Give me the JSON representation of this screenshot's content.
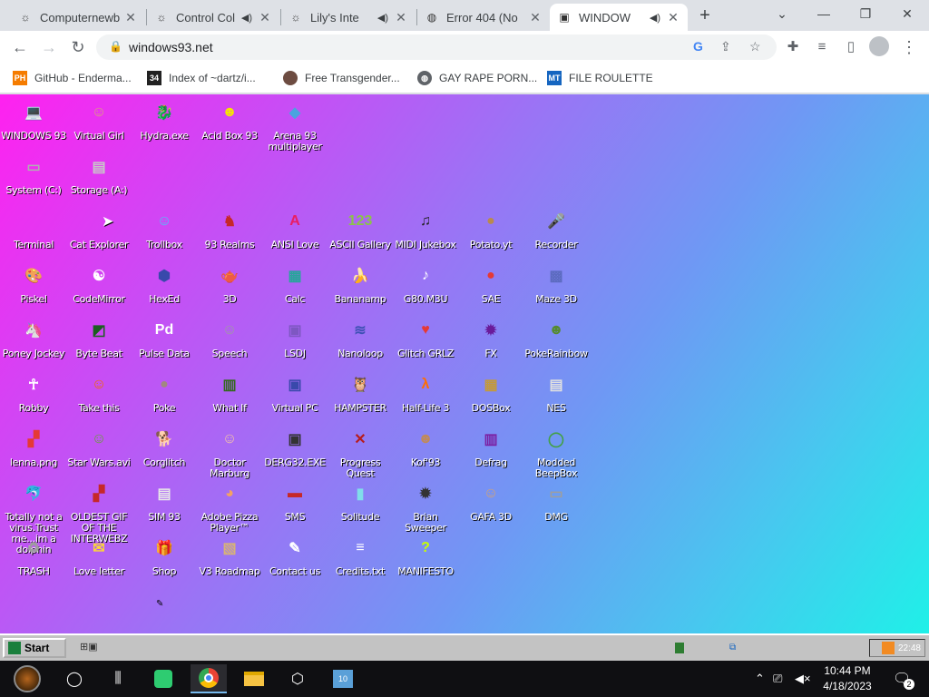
{
  "browser": {
    "tabs": [
      {
        "title": "Computernewb",
        "favicon": "c-icon",
        "audio": false,
        "active": false
      },
      {
        "title": "Control Col",
        "favicon": "c-icon",
        "audio": true,
        "active": false
      },
      {
        "title": "Lily's Inte",
        "favicon": "c-icon",
        "audio": true,
        "active": false
      },
      {
        "title": "Error 404 (No",
        "favicon": "globe-icon",
        "audio": true,
        "active": false
      },
      {
        "title": "WINDOW",
        "favicon": "w93-icon",
        "audio": true,
        "active": true
      }
    ],
    "new_tab_label": "+",
    "url": "windows93.net",
    "bookmarks": [
      {
        "label": "GitHub - Enderma...",
        "icon": "PH"
      },
      {
        "label": "Index of ~dartz/i...",
        "icon": "34"
      },
      {
        "label": "Free Transgender...",
        "icon": "avatar"
      },
      {
        "label": "GAY RAPE PORN...",
        "icon": "globe"
      },
      {
        "label": "FILE ROULETTE",
        "icon": "MT"
      }
    ]
  },
  "desktop": {
    "icons": [
      {
        "label": "WINDOWS 93",
        "glyph": "💻",
        "color": "#444"
      },
      {
        "label": "Virtual Girl",
        "glyph": "☺",
        "color": "#d9a27a"
      },
      {
        "label": "Hydra.exe",
        "glyph": "🐉",
        "color": "#2e7d32"
      },
      {
        "label": "Acid Box 93",
        "glyph": "☻",
        "color": "#f5e600"
      },
      {
        "label": "Arena 93 multiplayer",
        "glyph": "◆",
        "color": "#4aa3df"
      },
      {
        "label": "System (C:)",
        "glyph": "▭",
        "color": "#b0b0b0"
      },
      {
        "label": "Storage (A:)",
        "glyph": "▤",
        "color": "#c8c8c8"
      },
      {
        "label": "Terminal",
        "glyph": "",
        "color": "transparent"
      },
      {
        "label": "Cat Explorer",
        "glyph": "",
        "color": "transparent"
      },
      {
        "label": "Trollbox",
        "glyph": "☺",
        "color": "#4fc3f7"
      },
      {
        "label": "93 Realms",
        "glyph": "♞",
        "color": "#c62828"
      },
      {
        "label": "ANSI Love",
        "glyph": "A",
        "color": "#e91e63"
      },
      {
        "label": "ASCII Gallery",
        "glyph": "123",
        "color": "#8bc34a"
      },
      {
        "label": "MIDI Jukebox",
        "glyph": "♫",
        "color": "#222"
      },
      {
        "label": "Potato.yt",
        "glyph": "●",
        "color": "#b98a4e"
      },
      {
        "label": "Recorder",
        "glyph": "🎤",
        "color": "#555"
      },
      {
        "label": "Piskel",
        "glyph": "🎨",
        "color": "#e6c07b"
      },
      {
        "label": "CodeMirror",
        "glyph": "☯",
        "color": "#fff"
      },
      {
        "label": "HexEd",
        "glyph": "⬢",
        "color": "#3949ab"
      },
      {
        "label": "3D",
        "glyph": "🫖",
        "color": "#f8bbd0"
      },
      {
        "label": "Calc",
        "glyph": "▦",
        "color": "#26a69a"
      },
      {
        "label": "Bananamp",
        "glyph": "🍌",
        "color": "#fdd835"
      },
      {
        "label": "G80.M3U",
        "glyph": "♪",
        "color": "#fff"
      },
      {
        "label": "SAE",
        "glyph": "●",
        "color": "#e53935"
      },
      {
        "label": "Maze 3D",
        "glyph": "▩",
        "color": "#5c6bc0"
      },
      {
        "label": "Poney Jockey",
        "glyph": "🦄",
        "color": "#ce93d8"
      },
      {
        "label": "Byte Beat",
        "glyph": "◩",
        "color": "#1b5e20"
      },
      {
        "label": "Pulse Data",
        "glyph": "Pd",
        "color": "#fff"
      },
      {
        "label": "Speech",
        "glyph": "☺",
        "color": "#9e9e9e"
      },
      {
        "label": "LSDJ",
        "glyph": "▣",
        "color": "#7e57c2"
      },
      {
        "label": "Nanoloop",
        "glyph": "≋",
        "color": "#3f51b5"
      },
      {
        "label": "Glitch GRLZ",
        "glyph": "♥",
        "color": "#e53935"
      },
      {
        "label": "FX",
        "glyph": "✹",
        "color": "#6a1b9a"
      },
      {
        "label": "PokeRainbow",
        "glyph": "☻",
        "color": "#558b2f"
      },
      {
        "label": "Robby",
        "glyph": "☥",
        "color": "#fff"
      },
      {
        "label": "Take this",
        "glyph": "☺",
        "color": "#ef6c00"
      },
      {
        "label": "Poke",
        "glyph": "●",
        "color": "#a1887f"
      },
      {
        "label": "What If",
        "glyph": "▥",
        "color": "#33691e"
      },
      {
        "label": "Virtual PC",
        "glyph": "▣",
        "color": "#3949ab"
      },
      {
        "label": "HAMPSTER",
        "glyph": "🦉",
        "color": "#eee"
      },
      {
        "label": "Half-Life 3",
        "glyph": "λ",
        "color": "#ff6d00"
      },
      {
        "label": "DOSBox",
        "glyph": "▦",
        "color": "#c49a3a"
      },
      {
        "label": "NES",
        "glyph": "▤",
        "color": "#e0e0e0"
      },
      {
        "label": "lenna.png",
        "glyph": "▞",
        "color": "#e53935"
      },
      {
        "label": "Star Wars.avi",
        "glyph": "☺",
        "color": "#689f38"
      },
      {
        "label": "Corglitch",
        "glyph": "🐕",
        "color": "#f4a261"
      },
      {
        "label": "Doctor Marburg",
        "glyph": "☺",
        "color": "#f5c6a5"
      },
      {
        "label": "DERG32.EXE",
        "glyph": "▣",
        "color": "#333"
      },
      {
        "label": "Progress Quest",
        "glyph": "✕",
        "color": "#b71c1c"
      },
      {
        "label": "Kof'93",
        "glyph": "☻",
        "color": "#c08a5a"
      },
      {
        "label": "Defrag",
        "glyph": "▥",
        "color": "#7b1fa2"
      },
      {
        "label": "Modded BeepBox",
        "glyph": "◯",
        "color": "#43a047"
      },
      {
        "label": "Totally not a virus.Trust me...im a dolphin",
        "glyph": "🐬",
        "color": "#29b6f6"
      },
      {
        "label": "OLDEST GIF OF THE INTERWEBZ",
        "glyph": "▞",
        "color": "#c62828"
      },
      {
        "label": "SIM 93",
        "glyph": "▤",
        "color": "#e8e8e8"
      },
      {
        "label": "Adobe Pizza Player™",
        "glyph": "◕",
        "color": "#f4a261"
      },
      {
        "label": "SMS",
        "glyph": "▬",
        "color": "#c62828"
      },
      {
        "label": "Solitude",
        "glyph": "▮",
        "color": "#80deea"
      },
      {
        "label": "Brian Sweeper",
        "glyph": "✹",
        "color": "#333"
      },
      {
        "label": "GAFA 3D",
        "glyph": "☺",
        "color": "#d4a373"
      },
      {
        "label": "DMG",
        "glyph": "▭",
        "color": "#9e9e9e"
      },
      {
        "label": "TRASH",
        "glyph": "♻",
        "color": "#9e9e9e"
      },
      {
        "label": "Love letter",
        "glyph": "✉",
        "color": "#fdd835"
      },
      {
        "label": "Shop",
        "glyph": "🎁",
        "color": "#e53935"
      },
      {
        "label": "V3 Roadmap",
        "glyph": "▧",
        "color": "#d7b377"
      },
      {
        "label": "Contact us",
        "glyph": "✎",
        "color": "#fff"
      },
      {
        "label": "Credits.txt",
        "glyph": "≡",
        "color": "#fff"
      },
      {
        "label": "MANIFESTO",
        "glyph": "?",
        "color": "#c6ff00"
      }
    ]
  },
  "w93taskbar": {
    "start_label": "Start",
    "tray_time": "22:48"
  },
  "os": {
    "clock_time": "10:44 PM",
    "clock_date": "4/18/2023",
    "notification_count": "2"
  }
}
